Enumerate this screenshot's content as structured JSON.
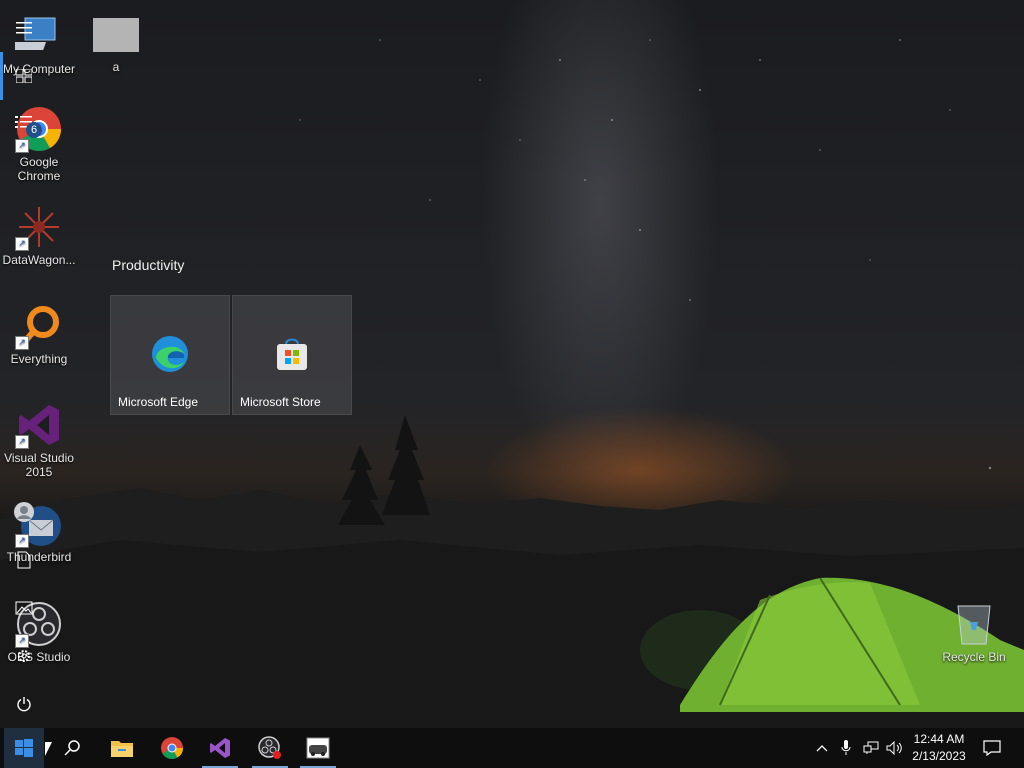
{
  "desktop": {
    "icons": [
      {
        "label": "My Computer"
      },
      {
        "label": "a"
      },
      {
        "label": "Google Chrome"
      },
      {
        "label": "DataWagon..."
      },
      {
        "label": "Everything"
      },
      {
        "label": "Visual Studio 2015"
      },
      {
        "label": "Thunderbird"
      },
      {
        "label": "OBS Studio"
      },
      {
        "label": "Recycle Bin"
      }
    ]
  },
  "start_menu": {
    "badge_count": "6",
    "group_title": "Productivity",
    "tiles": [
      {
        "label": "Microsoft Edge",
        "icon": "edge-icon"
      },
      {
        "label": "Microsoft Store",
        "icon": "store-icon"
      }
    ]
  },
  "taskbar": {
    "clock_time": "12:44 AM",
    "clock_date": "2/13/2023",
    "apps": [
      "file-explorer-icon",
      "chrome-icon",
      "visual-studio-icon",
      "obs-icon",
      "app-icon"
    ]
  },
  "colors": {
    "accent": "#3a8ee6",
    "taskbar": "#0e0e0f",
    "tile": "#4e4e52"
  }
}
